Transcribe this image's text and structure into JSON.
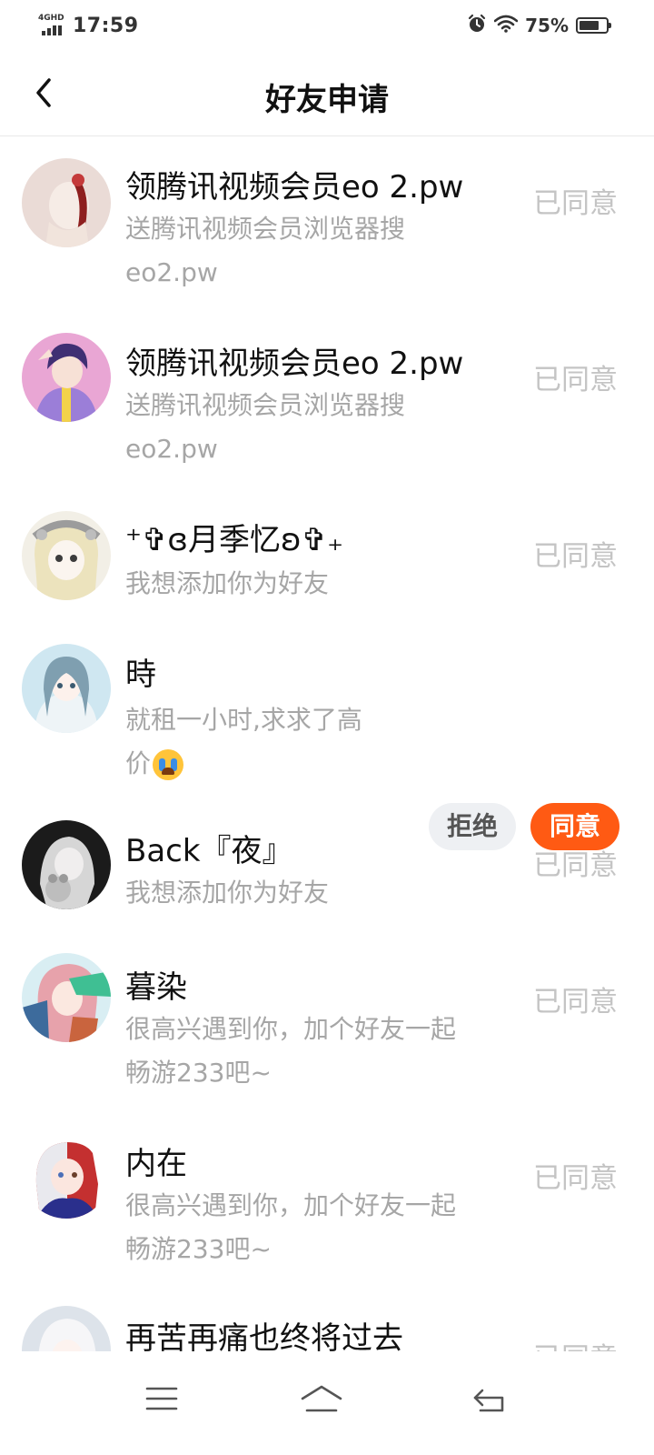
{
  "status_bar": {
    "network": "4GHD",
    "time": "17:59",
    "battery_percent": "75%",
    "battery_level": 0.75,
    "icons": [
      "alarm-icon",
      "wifi-icon",
      "battery-icon"
    ]
  },
  "header": {
    "title": "好友申请",
    "back_icon": "chevron-left-icon"
  },
  "colors": {
    "accent": "#ff5a13",
    "muted_text": "#a6a6a6",
    "status_text": "#c4c4c4",
    "reject_bg": "#eef0f3"
  },
  "requests": [
    {
      "name": "领腾讯视频会员eo 2.pw",
      "message_line1": "送腾讯视频会员浏览器搜",
      "message_line2": "eo2.pw",
      "status": "已同意"
    },
    {
      "name": "领腾讯视频会员eo 2.pw",
      "message_line1": "送腾讯视频会员浏览器搜",
      "message_line2": "eo2.pw",
      "status": "已同意"
    },
    {
      "name": "⁺✞ɞ月季忆ʚ✞₊",
      "message_line1": "我想添加你为好友",
      "status": "已同意"
    },
    {
      "name": "時",
      "message_line1": "就租一小时,求求了高",
      "message_line2": "价",
      "reject_label": "拒绝",
      "accept_label": "同意"
    },
    {
      "name": "Back『夜』",
      "message_line1": "我想添加你为好友",
      "status": "已同意"
    },
    {
      "name": "暮染",
      "message_line1": "很高兴遇到你，加个好友一起",
      "message_line2": "畅游233吧~",
      "status": "已同意"
    },
    {
      "name": "内在",
      "message_line1": "很高兴遇到你，加个好友一起",
      "message_line2": "畅游233吧~",
      "status": "已同意"
    },
    {
      "name": "再苦再痛也终将过去",
      "status": "已同意"
    }
  ],
  "bottom_nav": [
    "menu-icon",
    "home-icon",
    "back-icon"
  ]
}
